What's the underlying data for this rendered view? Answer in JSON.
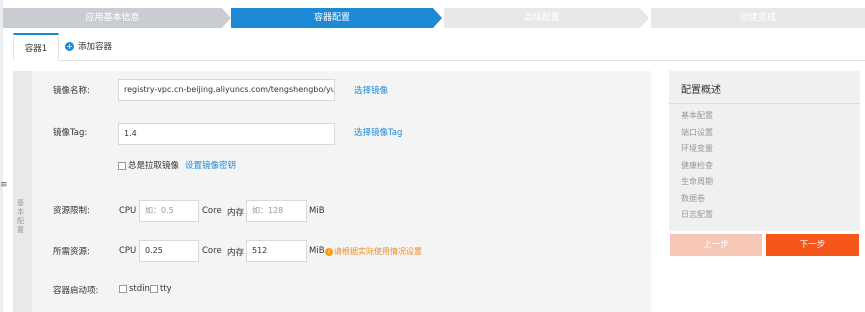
{
  "steps": [
    {
      "label": "应用基本信息",
      "state": "done"
    },
    {
      "label": "容器配置",
      "state": "active"
    },
    {
      "label": "高级配置",
      "state": "todo"
    },
    {
      "label": "创建完成",
      "state": "todo"
    }
  ],
  "tabs": {
    "active_label": "容器1",
    "add_label": "添加容器"
  },
  "form": {
    "side_label": "基本配置",
    "image_name_label": "镜像名称:",
    "image_name_value": "registry-vpc.cn-beijing.aliyuncs.com/tengshengbo/yunpi",
    "select_image_link": "选择镜像",
    "image_tag_label": "镜像Tag:",
    "image_tag_value": "1.4",
    "select_tag_link": "选择镜像Tag",
    "always_pull_label": "总是拉取镜像",
    "set_secret_link": "设置镜像密钥",
    "resource_limit_label": "资源限制:",
    "cpu_label": "CPU",
    "limit_cpu_placeholder": "如：0.5",
    "core_label": "Core",
    "memory_label": "内存",
    "limit_mem_placeholder": "如：128",
    "mib_label": "MiB",
    "resource_request_label": "所需资源:",
    "request_cpu_value": "0.25",
    "request_mem_value": "512",
    "warning_text": "请根据实际使用情况设置",
    "startup_label": "容器启动项:",
    "stdin_label": "stdin",
    "tty_label": "tty"
  },
  "summary": {
    "title": "配置概述",
    "items": [
      "基本配置",
      "端口设置",
      "环境变量",
      "健康检查",
      "生命周期",
      "数据卷",
      "日志配置"
    ]
  },
  "buttons": {
    "prev_label": "上一步",
    "next_label": "下一步"
  },
  "colors": {
    "accent": "#1e8ad6",
    "primary_button": "#f5571b",
    "warning": "#f08c1a"
  }
}
